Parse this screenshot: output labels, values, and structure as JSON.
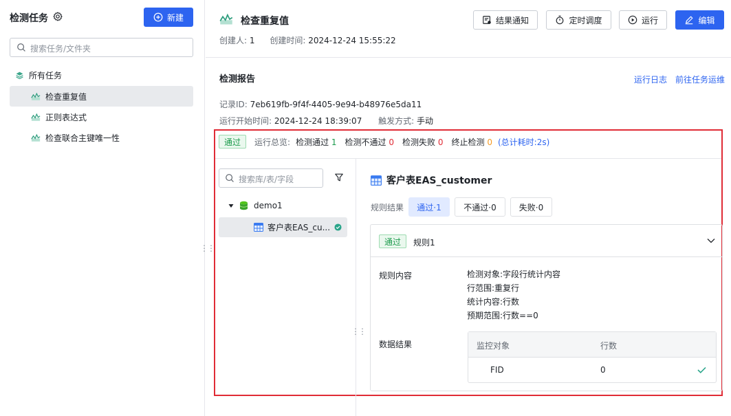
{
  "sidebar": {
    "title": "检测任务",
    "new_button": "新建",
    "search_placeholder": "搜索任务/文件夹",
    "root": "所有任务",
    "tasks": [
      "检查重复值",
      "正则表达式",
      "检查联合主键唯一性"
    ]
  },
  "header": {
    "title": "检查重复值",
    "creator_label": "创建人:",
    "creator": "1",
    "created_label": "创建时间:",
    "created_time": "2024-12-24 15:55:22",
    "buttons": {
      "notify": "结果通知",
      "schedule": "定时调度",
      "run": "运行",
      "edit": "编辑"
    }
  },
  "report": {
    "title": "检测报告",
    "link_log": "运行日志",
    "link_ops": "前往任务运维",
    "record_label": "记录ID:",
    "record_id": "7eb619fb-9f4f-4405-9e94-b48976e5da11",
    "start_label": "运行开始时间:",
    "start_time": "2024-12-24 18:39:07",
    "trigger_label": "触发方式:",
    "trigger": "手动"
  },
  "overview": {
    "status": "通过",
    "label": "运行总览:",
    "pass_label": "检测通过",
    "pass": "1",
    "fail_label": "检测不通过",
    "fail": "0",
    "error_label": "检测失败",
    "error": "0",
    "stop_label": "终止检测",
    "stop": "0",
    "total": "(总计耗时:2s)"
  },
  "tree": {
    "search_placeholder": "搜索库/表/字段",
    "db": "demo1",
    "table": "客户表EAS_cu..."
  },
  "detail": {
    "title": "客户表EAS_customer",
    "rule_result_label": "规则结果",
    "filters": [
      "通过·1",
      "不通过·0",
      "失败·0"
    ],
    "rule": {
      "status": "通过",
      "name": "规则1",
      "content_label": "规则内容",
      "content_lines": [
        "检测对象:字段行统计内容",
        "行范围:重复行",
        "统计内容:行数",
        "预期范围:行数==0"
      ],
      "data_label": "数据结果",
      "table_headers": [
        "监控对象",
        "行数"
      ],
      "rows": [
        {
          "object": "FID",
          "count": "0"
        }
      ]
    }
  },
  "colors": {
    "primary": "#2d64f0",
    "success": "#1a9a4b",
    "danger": "#e02b35",
    "warning": "#f59a23"
  }
}
